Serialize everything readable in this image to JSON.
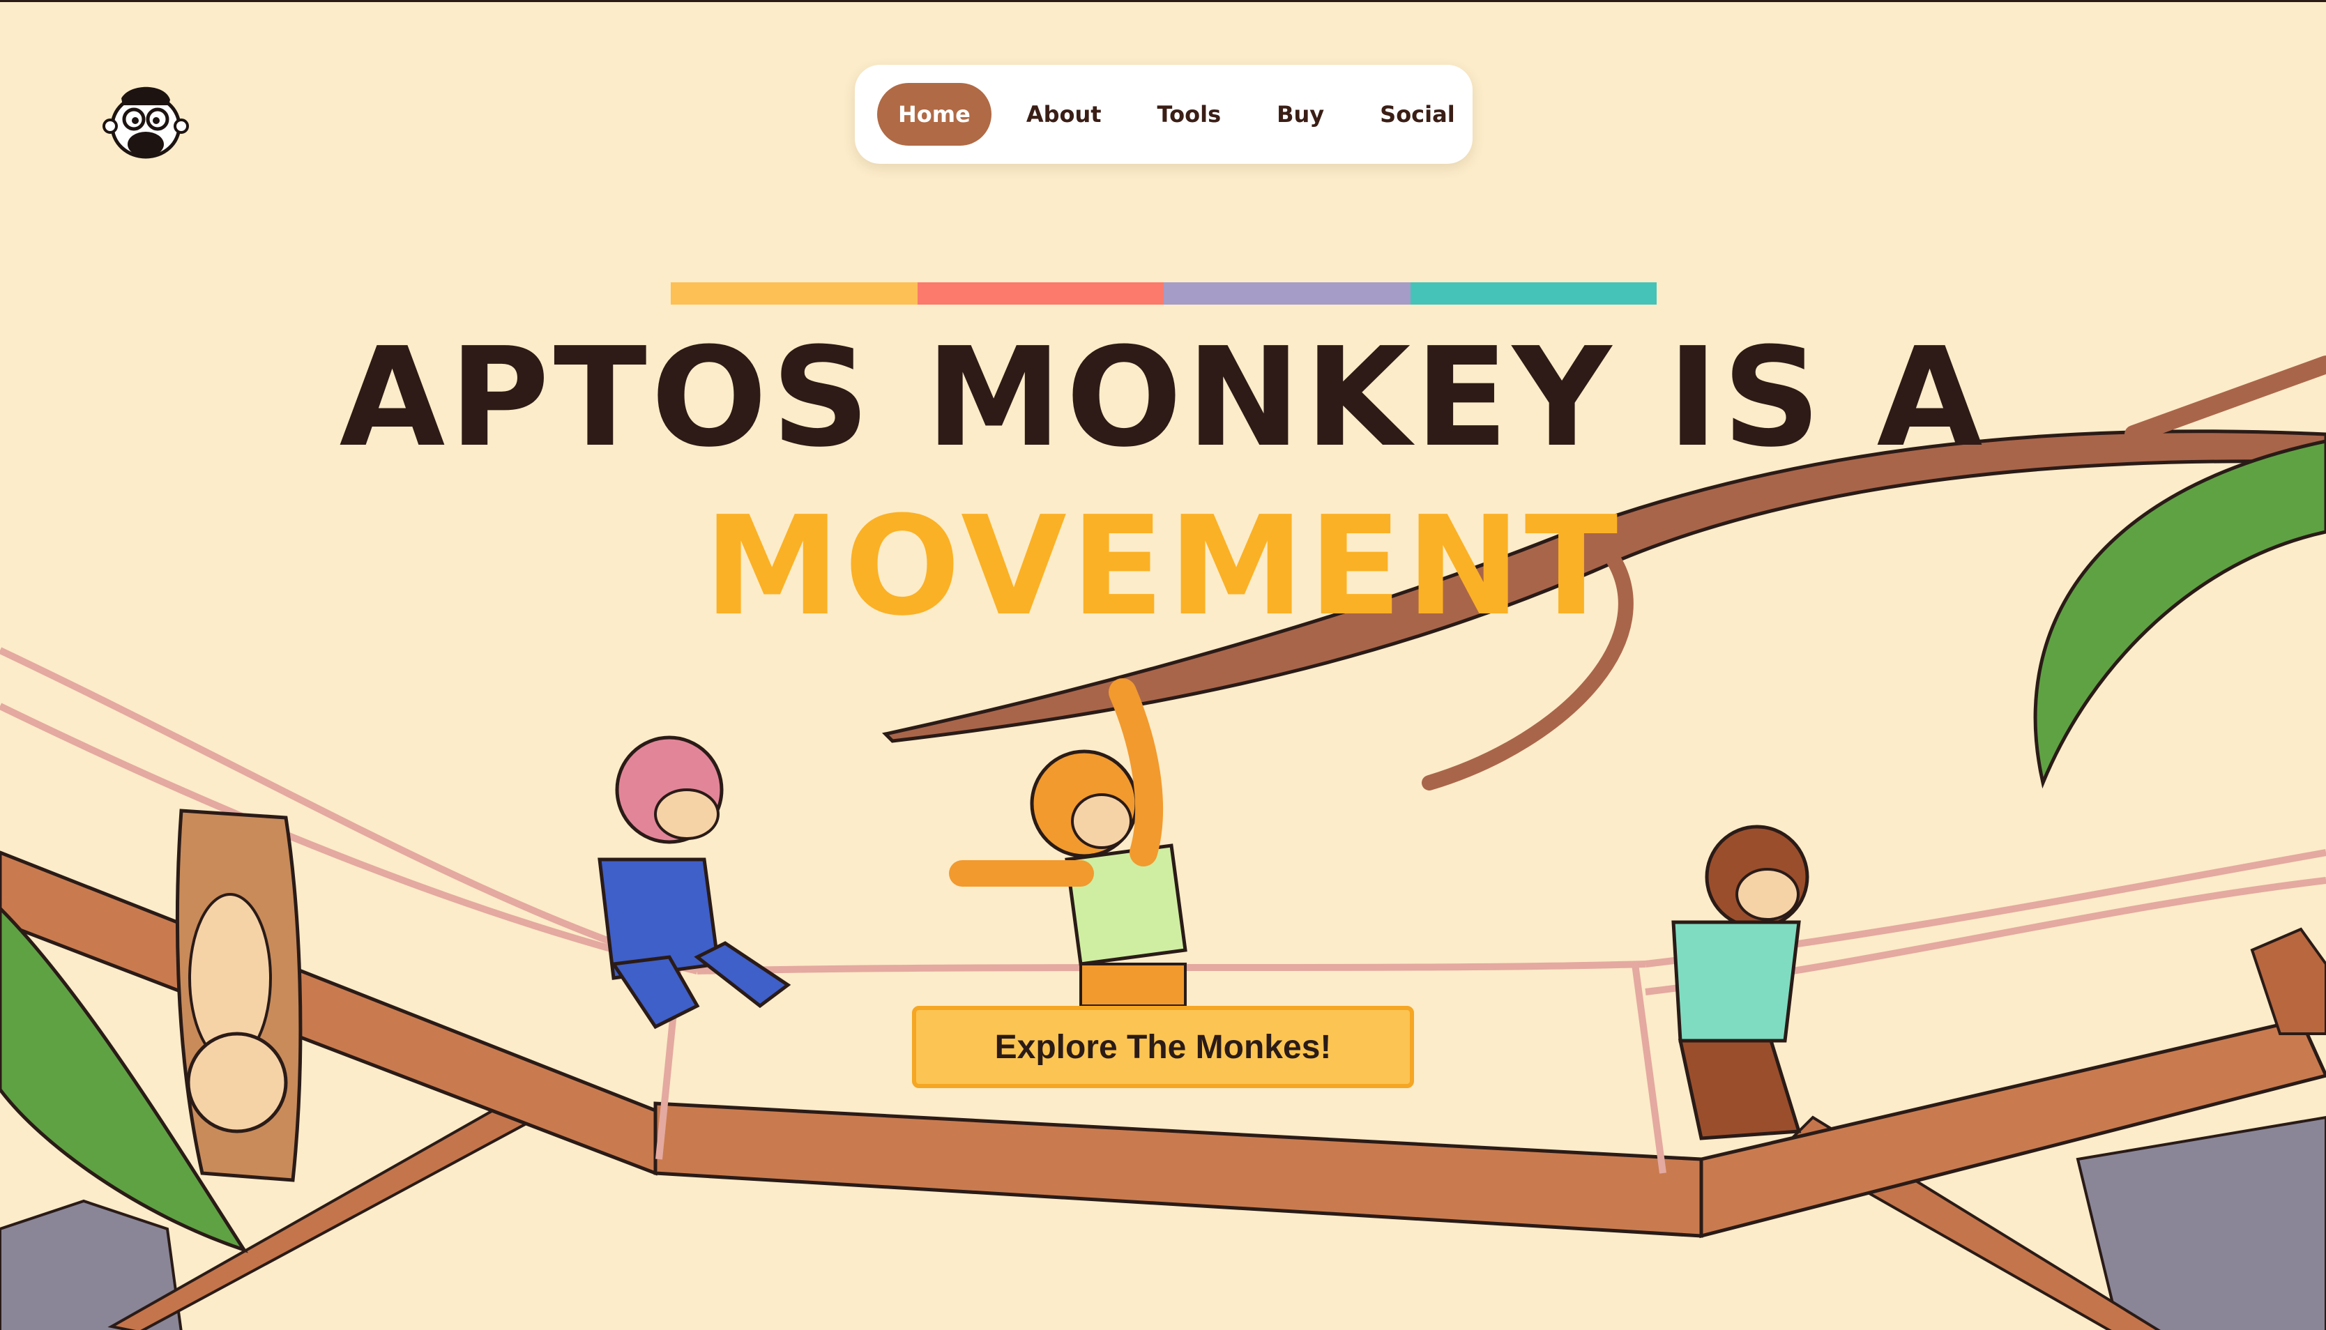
{
  "nav": {
    "items": [
      {
        "label": "Home",
        "active": true
      },
      {
        "label": "About",
        "active": false
      },
      {
        "label": "Tools",
        "active": false
      },
      {
        "label": "Buy",
        "active": false
      },
      {
        "label": "Social",
        "active": false
      }
    ]
  },
  "hero": {
    "line1": "APTOS MONKEY IS A",
    "line2": "MOVEMENT",
    "cta_label": "Explore The Monkes!"
  },
  "stripe_colors": [
    "#fdc055",
    "#fb7a6b",
    "#a59cc8",
    "#45c3b8"
  ],
  "colors": {
    "background": "#fcecc9",
    "headline": "#2e1b17",
    "accent": "#fbb125",
    "nav_active": "#b06a45",
    "cta": "#fcc452"
  },
  "icons": [
    "monkey-logo-icon"
  ]
}
